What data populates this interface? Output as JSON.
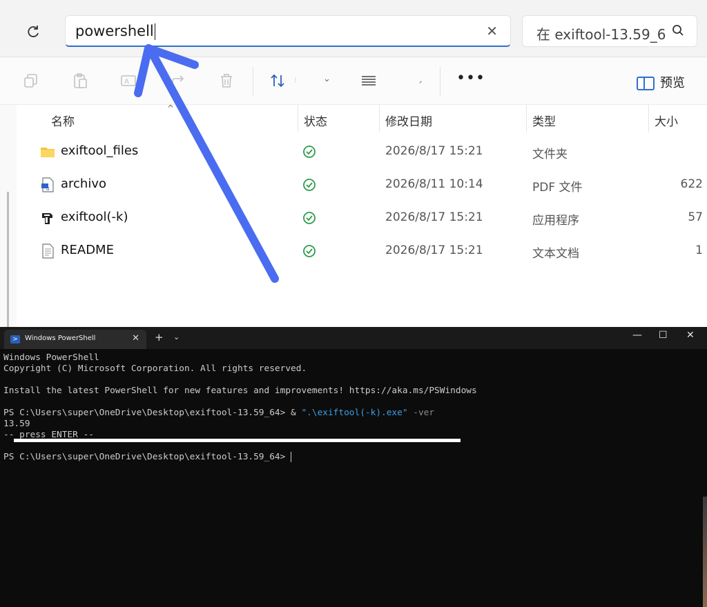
{
  "address_bar": {
    "value": "powershell",
    "search_placeholder": "在 exiftool-13.59_6"
  },
  "toolbar": {
    "preview_label": "预览"
  },
  "columns": {
    "name": "名称",
    "status": "状态",
    "modified": "修改日期",
    "type": "类型",
    "size": "大小"
  },
  "files": [
    {
      "name": "exiftool_files",
      "date": "2026/8/17 15:21",
      "type": "文件夹",
      "size": "",
      "icon": "folder-icon"
    },
    {
      "name": "archivo",
      "date": "2026/8/11 10:14",
      "type": "PDF 文件",
      "size": "622",
      "icon": "pdf-file-icon"
    },
    {
      "name": "exiftool(-k)",
      "date": "2026/8/17 15:21",
      "type": "应用程序",
      "size": "57",
      "icon": "exe-camel-icon"
    },
    {
      "name": "README",
      "date": "2026/8/17 15:21",
      "type": "文本文档",
      "size": "1",
      "icon": "text-file-icon"
    }
  ],
  "terminal": {
    "tab_title": "Windows PowerShell",
    "line1": "Windows PowerShell",
    "line2": "Copyright (C) Microsoft Corporation. All rights reserved.",
    "line3": "Install the latest PowerShell for new features and improvements! https://aka.ms/PSWindows",
    "prompt1": "PS C:\\Users\\super\\OneDrive\\Desktop\\exiftool-13.59_64> & ",
    "command_string": "\".\\exiftool(-k).exe\"",
    "command_param": " -ver",
    "output_version": "13.59",
    "output_press": "-- press ENTER --",
    "prompt2": "PS C:\\Users\\super\\OneDrive\\Desktop\\exiftool-13.59_64> "
  },
  "colors": {
    "accent": "#2f6fcf",
    "arrow": "#4a6cf0",
    "status_ok": "#2e9a4d",
    "terminal_bg": "#0c0c0c"
  }
}
